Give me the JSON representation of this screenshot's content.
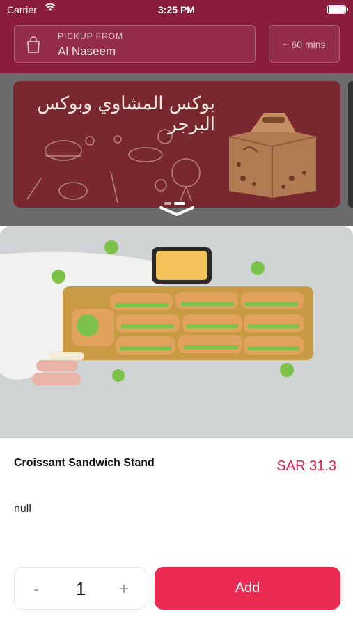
{
  "status": {
    "carrier": "Carrier",
    "time": "3:25 PM"
  },
  "header": {
    "pickup_label": "PICKUP FROM",
    "pickup_location": "Al Naseem",
    "eta": "~ 60 mins"
  },
  "banner": {
    "headline": "بوكس المشاوي وبوكس البرجر",
    "slides": 2,
    "active_slide": 2
  },
  "product": {
    "name": "Croissant Sandwich Stand",
    "price": "SAR 31.3",
    "description": "null",
    "quantity": "1",
    "minus_label": "-",
    "plus_label": "+",
    "add_label": "Add"
  },
  "colors": {
    "header": "#8a1c3c",
    "accent": "#ea2b52",
    "price": "#e01c50"
  },
  "icons": [
    "wifi-icon",
    "battery-icon",
    "shopping-bag-icon",
    "chevron-down-icon"
  ]
}
